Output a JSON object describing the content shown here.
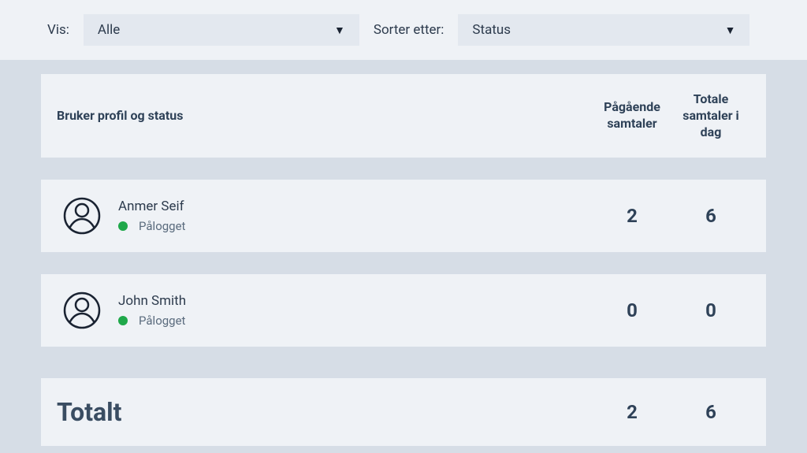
{
  "filters": {
    "vis_label": "Vis:",
    "vis_value": "Alle",
    "sort_label": "Sorter etter:",
    "sort_value": "Status"
  },
  "headers": {
    "profile": "Bruker profil og status",
    "ongoing": "Pågående samtaler",
    "total": "Totale samtaler i dag"
  },
  "users": [
    {
      "name": "Anmer Seif",
      "status": "Pålogget",
      "status_color": "#1fa84a",
      "ongoing": "2",
      "total": "6"
    },
    {
      "name": "John Smith",
      "status": "Pålogget",
      "status_color": "#1fa84a",
      "ongoing": "0",
      "total": "0"
    }
  ],
  "totals": {
    "label": "Totalt",
    "ongoing": "2",
    "total": "6"
  }
}
